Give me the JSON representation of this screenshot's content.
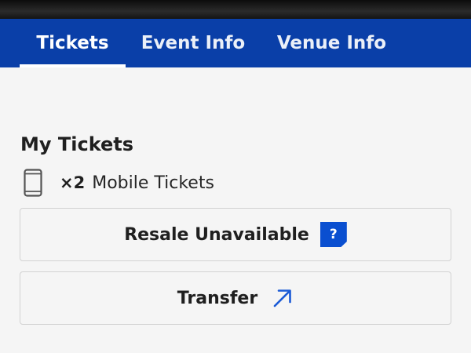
{
  "tabs": [
    {
      "label": "Tickets",
      "active": true
    },
    {
      "label": "Event Info",
      "active": false
    },
    {
      "label": "Venue Info",
      "active": false
    }
  ],
  "my_tickets": {
    "title": "My Tickets",
    "quantity": "×2",
    "type_label": "Mobile Tickets",
    "icon": "mobile-phone-icon"
  },
  "actions": {
    "resale_label": "Resale Unavailable",
    "resale_help": "?",
    "transfer_label": "Transfer",
    "transfer_icon": "arrow-up-right-icon"
  },
  "colors": {
    "brand_blue": "#0a3fa8",
    "help_badge_blue": "#0a4fd0",
    "accent_blue": "#1a5ad6"
  }
}
